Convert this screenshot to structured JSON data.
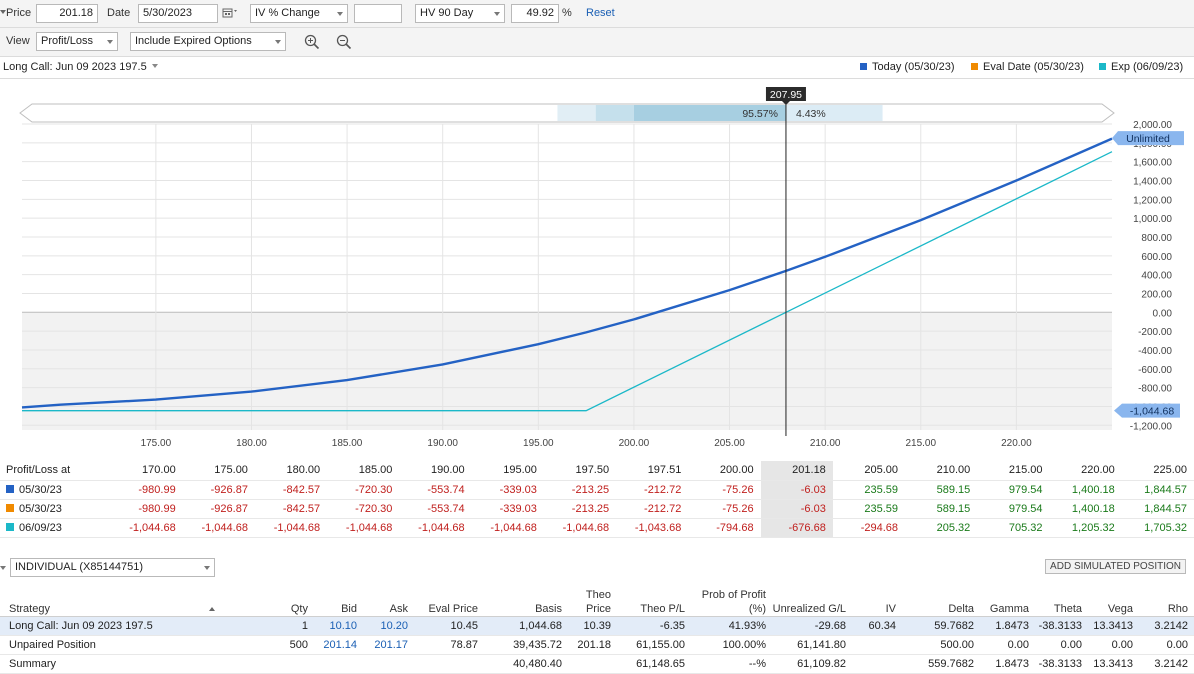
{
  "toolbar": {
    "price_label": "Price",
    "price_value": "201.18",
    "date_label": "Date",
    "date_value": "5/30/2023",
    "iv_mode": "IV % Change",
    "iv_input": "",
    "vol_source": "HV 90 Day",
    "vol_value": "49.92",
    "vol_unit": "%",
    "reset_label": "Reset",
    "view_label": "View",
    "view_mode": "Profit/Loss",
    "expired_option": "Include Expired Options"
  },
  "position_title": "Long Call: Jun 09 2023 197.5",
  "legend": [
    {
      "label": "Today (05/30/23)",
      "color": "#2462c4"
    },
    {
      "label": "Eval Date (05/30/23)",
      "color": "#f08a00"
    },
    {
      "label": "Exp (06/09/23)",
      "color": "#1bb8c8"
    }
  ],
  "probability": {
    "marker": "207.95",
    "left": "95.57%",
    "right": "4.43%"
  },
  "chart_data": {
    "type": "line",
    "xlabel": "",
    "ylabel": "",
    "xlim": [
      168,
      225
    ],
    "ylim": [
      -1250,
      2000
    ],
    "x_ticks": [
      "175.00",
      "180.00",
      "185.00",
      "190.00",
      "195.00",
      "200.00",
      "205.00",
      "210.00",
      "215.00",
      "220.00"
    ],
    "y_ticks": [
      "2,000.00",
      "1,800.00",
      "1,600.00",
      "1,400.00",
      "1,200.00",
      "1,000.00",
      "800.00",
      "600.00",
      "400.00",
      "200.00",
      "0.00",
      "-200.00",
      "-400.00",
      "-600.00",
      "-800.00",
      "-1,000.00",
      "-1,200.00"
    ],
    "marker_x": 207.95,
    "labels": {
      "upper": "Unlimited",
      "lower": "-1,044.68"
    },
    "series": [
      {
        "name": "Today (05/30/23)",
        "color": "#2462c4",
        "x": [
          168,
          170,
          175,
          180,
          185,
          190,
          195,
          197.5,
          200,
          205,
          207.95,
          210,
          215,
          220,
          225
        ],
        "y": [
          -1010,
          -980.99,
          -926.87,
          -842.57,
          -720.3,
          -553.74,
          -339.03,
          -213.25,
          -75.26,
          235.59,
          440,
          589.15,
          979.54,
          1400.18,
          1844.57
        ]
      },
      {
        "name": "Exp (06/09/23)",
        "color": "#1bb8c8",
        "x": [
          168,
          197.5,
          207.95,
          225
        ],
        "y": [
          -1044.68,
          -1044.68,
          0,
          1705.32
        ]
      }
    ]
  },
  "pl_table": {
    "header_label": "Profit/Loss at",
    "prices": [
      "170.00",
      "175.00",
      "180.00",
      "185.00",
      "190.00",
      "195.00",
      "197.50",
      "197.51",
      "200.00",
      "201.18",
      "205.00",
      "210.00",
      "215.00",
      "220.00",
      "225.00"
    ],
    "rows": [
      {
        "label": "05/30/23",
        "color": "#2462c4",
        "values": [
          "-980.99",
          "-926.87",
          "-842.57",
          "-720.30",
          "-553.74",
          "-339.03",
          "-213.25",
          "-212.72",
          "-75.26",
          "-6.03",
          "235.59",
          "589.15",
          "979.54",
          "1,400.18",
          "1,844.57"
        ]
      },
      {
        "label": "05/30/23",
        "color": "#f08a00",
        "values": [
          "-980.99",
          "-926.87",
          "-842.57",
          "-720.30",
          "-553.74",
          "-339.03",
          "-213.25",
          "-212.72",
          "-75.26",
          "-6.03",
          "235.59",
          "589.15",
          "979.54",
          "1,400.18",
          "1,844.57"
        ]
      },
      {
        "label": "06/09/23",
        "color": "#1bb8c8",
        "values": [
          "-1,044.68",
          "-1,044.68",
          "-1,044.68",
          "-1,044.68",
          "-1,044.68",
          "-1,044.68",
          "-1,044.68",
          "-1,043.68",
          "-794.68",
          "-676.68",
          "-294.68",
          "205.32",
          "705.32",
          "1,205.32",
          "1,705.32"
        ]
      }
    ]
  },
  "account": {
    "label": "INDIVIDUAL (X85144751)",
    "add_button": "ADD SIMULATED POSITION"
  },
  "positions": {
    "headers": [
      "Strategy",
      "Qty",
      "Bid",
      "Ask",
      "Eval Price",
      "Basis",
      "Theo Price",
      "Theo P/L",
      "Prob of Profit (%)",
      "Unrealized G/L",
      "IV",
      "Delta",
      "Gamma",
      "Theta",
      "Vega",
      "Rho"
    ],
    "rows": [
      [
        "Long Call: Jun 09 2023 197.5",
        "1",
        "10.10",
        "10.20",
        "10.45",
        "1,044.68",
        "10.39",
        "-6.35",
        "41.93%",
        "-29.68",
        "60.34",
        "59.7682",
        "1.8473",
        "-38.3133",
        "13.3413",
        "3.2142"
      ],
      [
        "Unpaired Position",
        "500",
        "201.14",
        "201.17",
        "78.87",
        "39,435.72",
        "201.18",
        "61,155.00",
        "100.00%",
        "61,141.80",
        "",
        "500.00",
        "0.00",
        "0.00",
        "0.00",
        "0.00"
      ],
      [
        "Summary",
        "",
        "",
        "",
        "",
        "40,480.40",
        "",
        "61,148.65",
        "--%",
        "61,109.82",
        "",
        "559.7682",
        "1.8473",
        "-38.3133",
        "13.3413",
        "3.2142"
      ]
    ]
  }
}
